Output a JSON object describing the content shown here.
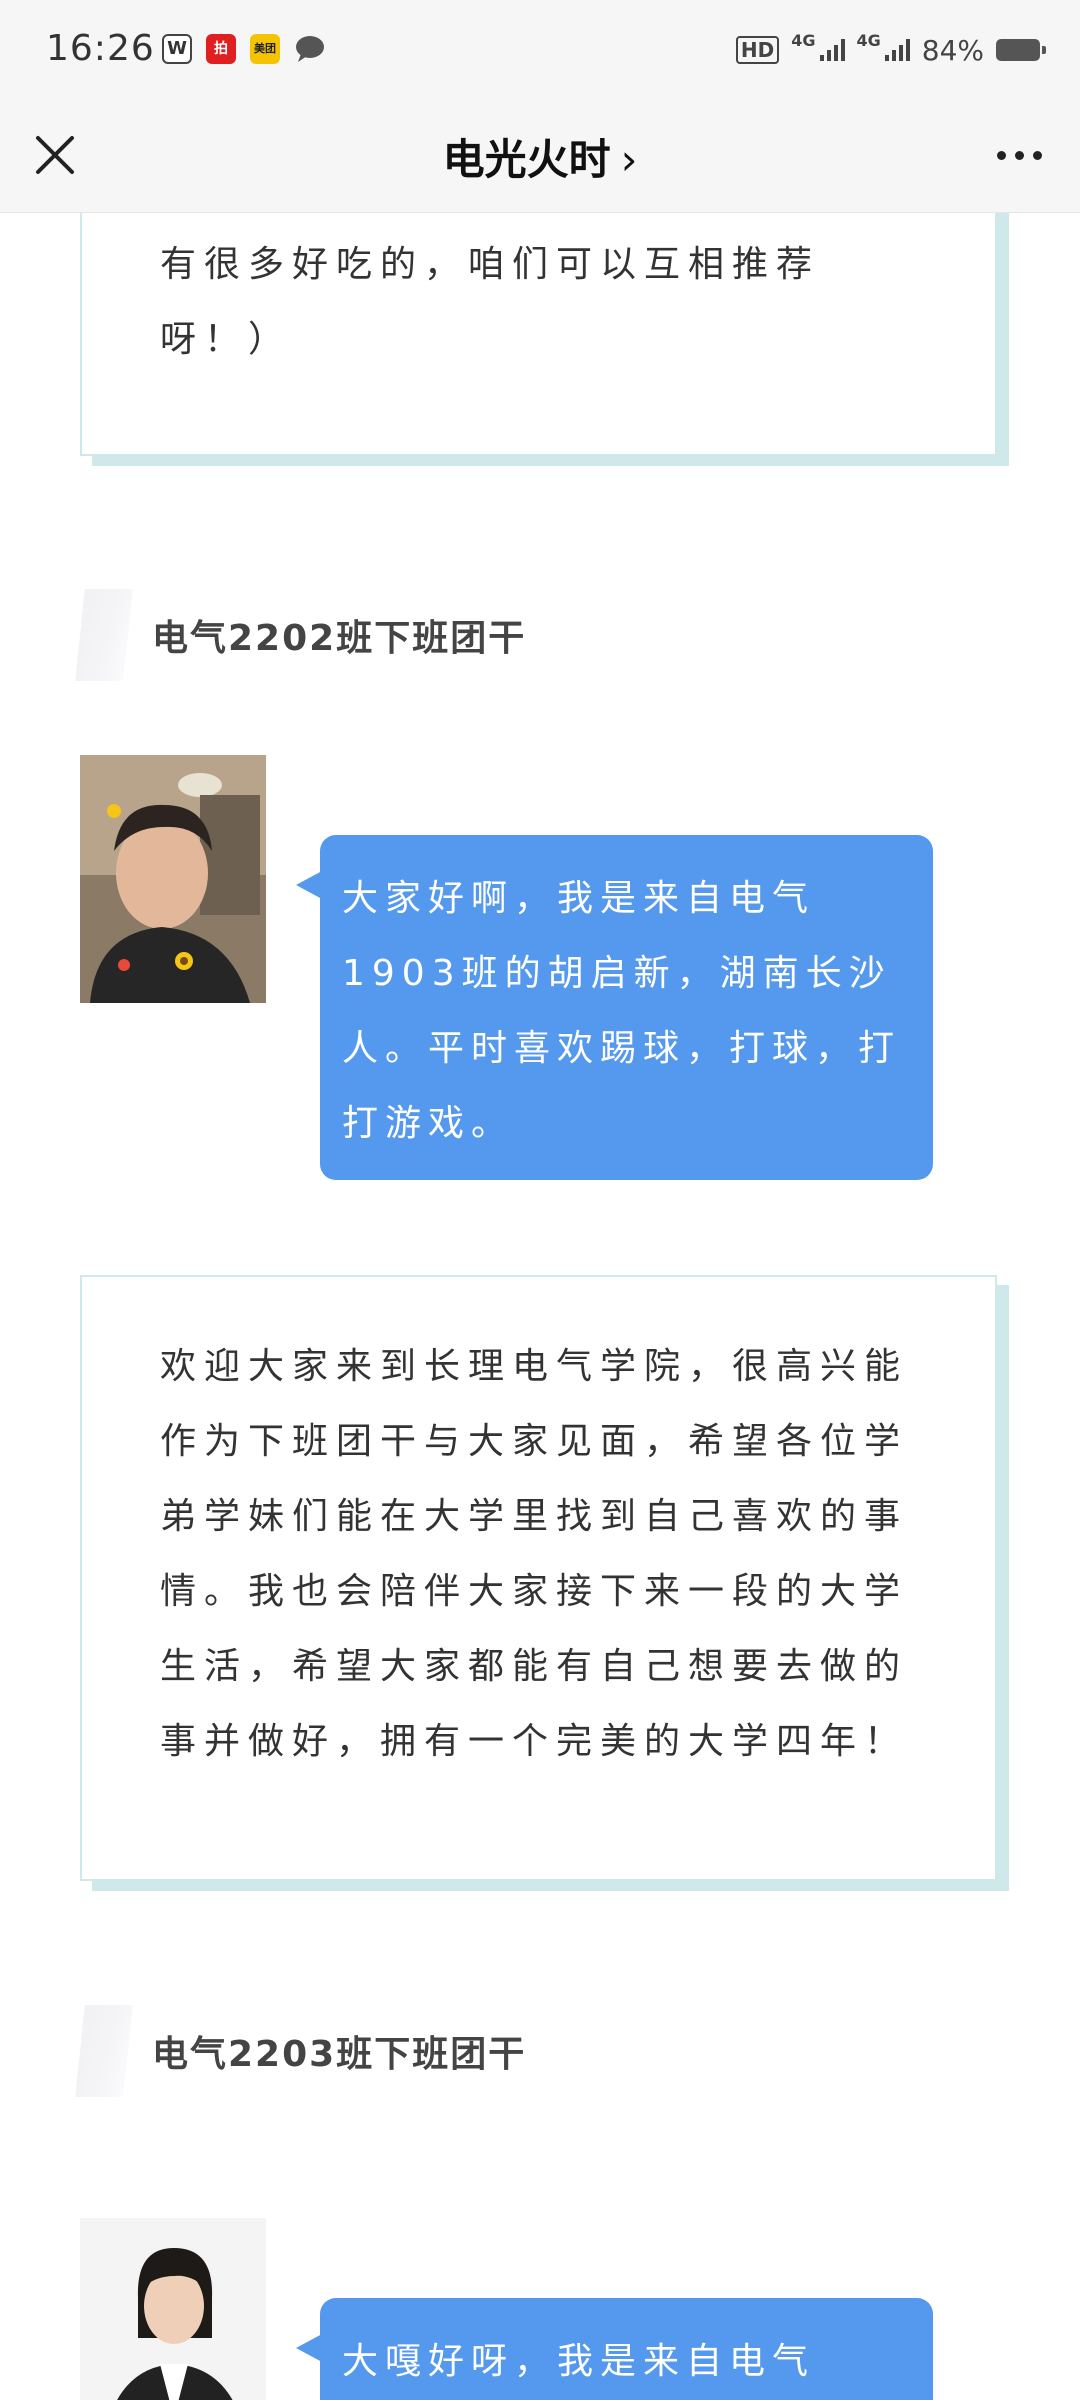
{
  "status_bar": {
    "time": "16:26",
    "apps": [
      {
        "icon": "wps-icon",
        "label": "W",
        "color": "#333333"
      },
      {
        "icon": "app-red-icon",
        "label": "拍",
        "color": "#e02020"
      },
      {
        "icon": "meituan-icon",
        "label": "美团",
        "color": "#f5c400"
      },
      {
        "icon": "chat-bubble-icon",
        "label": "",
        "color": "#555555"
      }
    ],
    "hd_label": "HD",
    "network_1": "4G",
    "network_2": "4G",
    "battery": "84%"
  },
  "nav": {
    "title": "电光火时",
    "chevron": "›"
  },
  "blocks": {
    "top_card_text": "有很多好吃的，咱们可以互相推荐呀！）",
    "section_1_title": "电气2202班下班团干",
    "bubble_1_text": "大家好啊，我是来自电气1903班的胡启新，湖南长沙人。平时喜欢踢球，打球，打打游戏。",
    "card_1_text": "欢迎大家来到长理电气学院，很高兴能作为下班团干与大家见面，希望各位学弟学妹们能在大学里找到自己喜欢的事情。我也会陪伴大家接下来一段的大学生活，希望大家都能有自己想要去做的事并做好，拥有一个完美的大学四年！",
    "section_2_title": "电气2203班下班团干",
    "bubble_2_text": "大嘎好呀，我是来自电气"
  },
  "colors": {
    "bubble": "#5499ed",
    "card_border": "#cfe8ea"
  }
}
